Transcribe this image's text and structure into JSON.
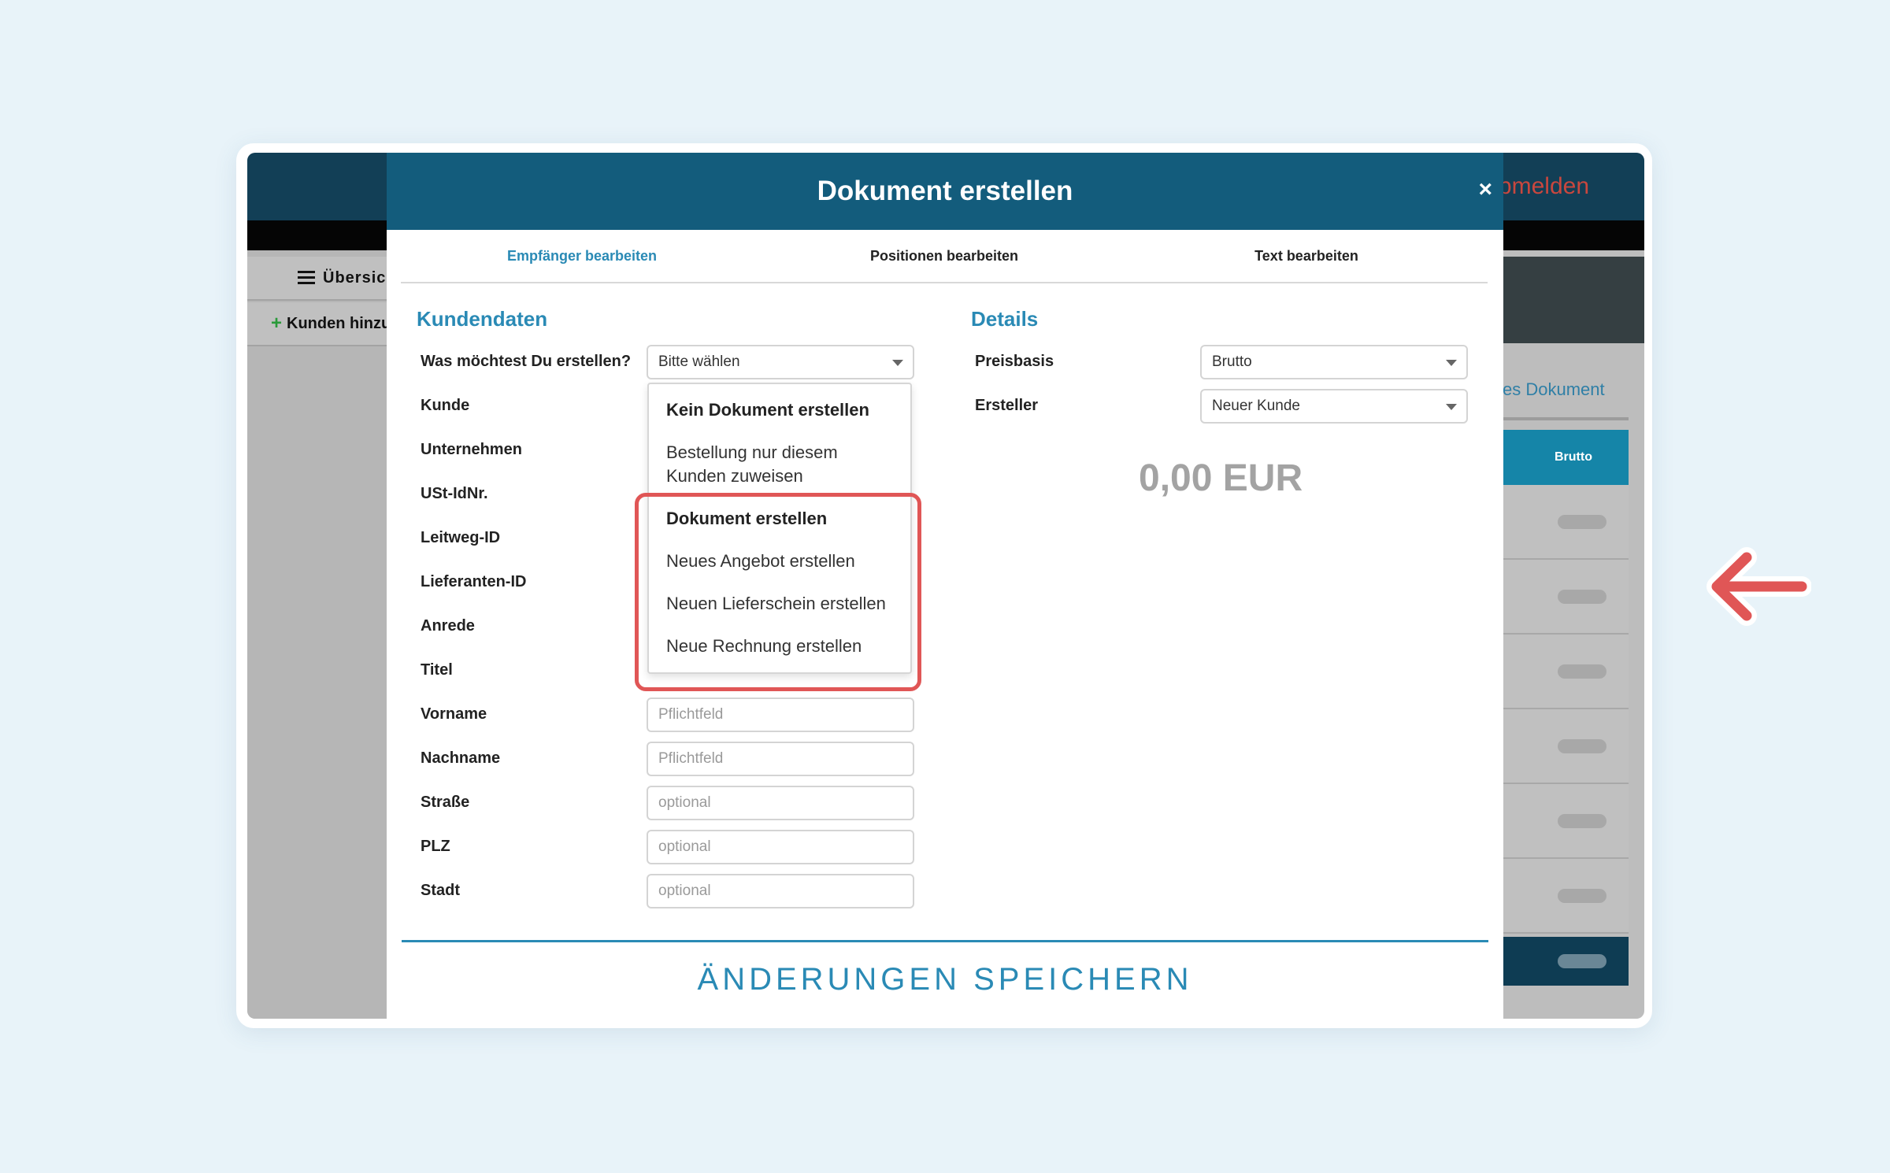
{
  "background_app": {
    "logout_label": "bmelden",
    "left_nav": [
      {
        "label": "Übersic"
      },
      {
        "label": "Kunden hinzu"
      }
    ],
    "new_document_link": "es Dokument",
    "table_header": "Brutto"
  },
  "modal": {
    "title": "Dokument erstellen",
    "close_label": "×",
    "tabs": [
      {
        "label": "Empfänger bearbeiten",
        "active": true
      },
      {
        "label": "Positionen bearbeiten",
        "active": false
      },
      {
        "label": "Text bearbeiten",
        "active": false
      }
    ],
    "kundendaten": {
      "title": "Kundendaten",
      "fields": [
        {
          "label": "Was möchtest Du erstellen?",
          "value": "Bitte wählen"
        },
        {
          "label": "Kunde"
        },
        {
          "label": "Unternehmen"
        },
        {
          "label": "USt-IdNr."
        },
        {
          "label": "Leitweg-ID"
        },
        {
          "label": "Lieferanten-ID"
        },
        {
          "label": "Anrede"
        },
        {
          "label": "Titel"
        },
        {
          "label": "Vorname",
          "placeholder": "Pflichtfeld"
        },
        {
          "label": "Nachname",
          "placeholder": "Pflichtfeld"
        },
        {
          "label": "Straße",
          "placeholder": "optional"
        },
        {
          "label": "PLZ",
          "placeholder": "optional"
        },
        {
          "label": "Stadt",
          "placeholder": "optional"
        }
      ]
    },
    "dropdown_options": [
      {
        "label": "Kein Dokument erstellen",
        "group_header": true
      },
      {
        "label": "Bestellung nur diesem Kunden zuweisen",
        "group_header": false
      },
      {
        "label": "Dokument erstellen",
        "group_header": true
      },
      {
        "label": "Neues Angebot erstellen",
        "group_header": false
      },
      {
        "label": "Neuen Lieferschein erstellen",
        "group_header": false
      },
      {
        "label": "Neue Rechnung erstellen",
        "group_header": false
      }
    ],
    "details": {
      "title": "Details",
      "fields": [
        {
          "label": "Preisbasis",
          "value": "Brutto"
        },
        {
          "label": "Ersteller",
          "value": "Neuer Kunde"
        }
      ],
      "amount": "0,00 EUR"
    },
    "save_label": "ÄNDERUNGEN SPEICHERN"
  },
  "colors": {
    "header": "#135c7c",
    "accent": "#2a8ab5",
    "highlight": "#e05656",
    "logout": "#c9473e"
  },
  "icons": {
    "close": "close-icon",
    "annotation_arrow": "arrow-left-icon",
    "list": "list-icon",
    "plus": "plus-icon"
  }
}
